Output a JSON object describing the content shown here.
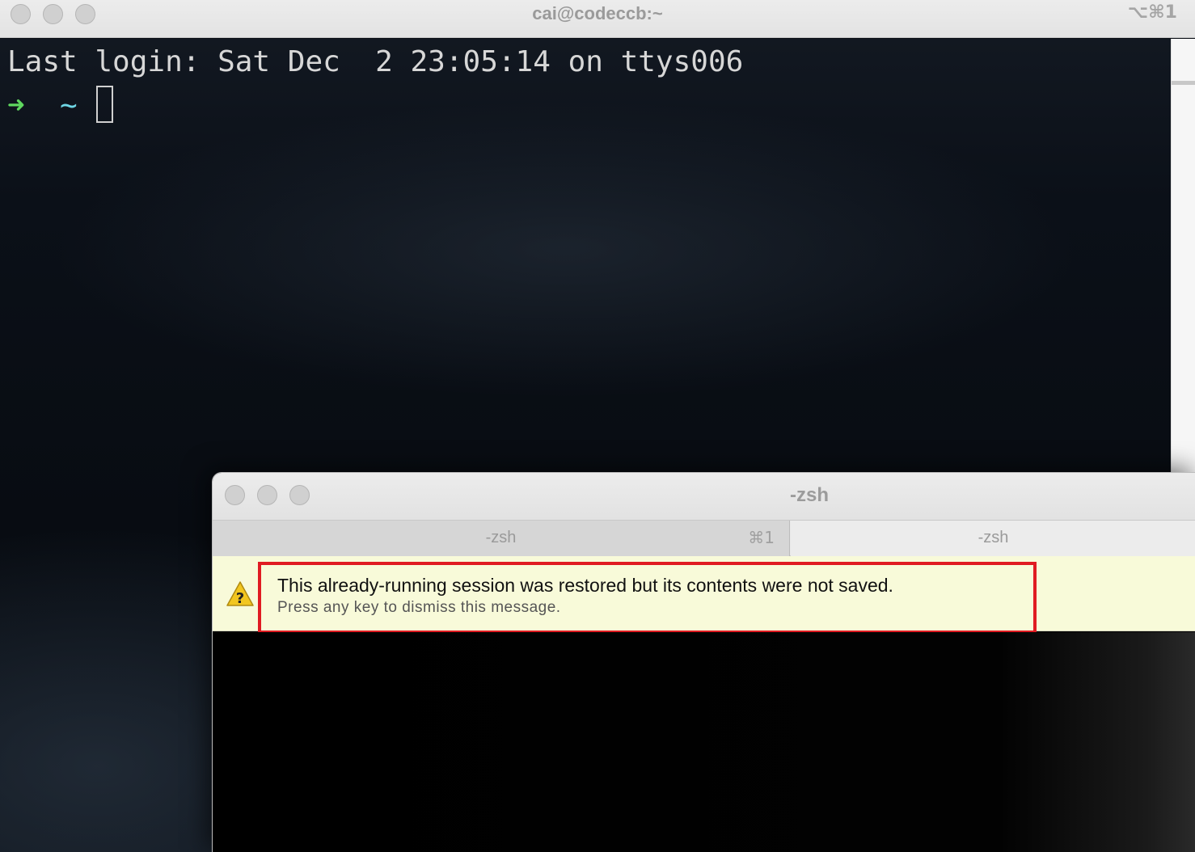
{
  "back_window": {
    "title": "cai@codeccb:~",
    "shortcut": "⌥⌘1",
    "terminal": {
      "last_login_line": "Last login: Sat Dec  2 23:05:14 on ttys006",
      "prompt_arrow": "➜",
      "prompt_dir": "~"
    }
  },
  "front_window": {
    "title": "-zsh",
    "tabs": [
      {
        "label": "-zsh",
        "shortcut": "⌘1",
        "active": true
      },
      {
        "label": "-zsh",
        "shortcut": "",
        "active": false
      }
    ],
    "banner": {
      "icon": "warning-question-icon",
      "icon_glyph": "?",
      "message": "This already-running session was restored but its contents were not saved.",
      "submessage": "Press any key to dismiss this message."
    }
  },
  "colors": {
    "highlight_border": "#e01b22",
    "banner_background": "#f8fad9",
    "prompt_arrow": "#5fd75f",
    "prompt_dir": "#6fd7e6"
  }
}
